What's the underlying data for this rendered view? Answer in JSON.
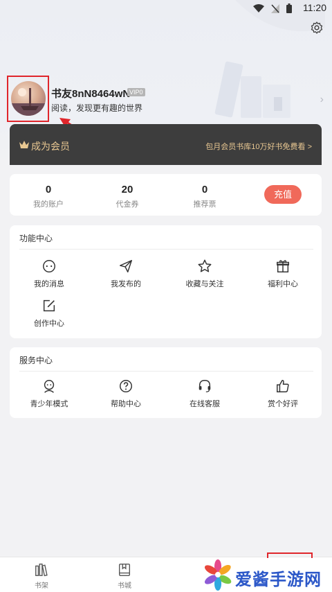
{
  "status_bar": {
    "time": "11:20"
  },
  "profile": {
    "username": "书友8nN8464wN",
    "vip_level": "VIP0",
    "signature": "阅读，发现更有趣的世界"
  },
  "vip_bar": {
    "title": "成为会员",
    "promo": "包月会员书库10万好书免费看 >"
  },
  "stats": [
    {
      "value": "0",
      "label": "我的账户"
    },
    {
      "value": "20",
      "label": "代金券"
    },
    {
      "value": "0",
      "label": "推荐票"
    }
  ],
  "recharge_label": "充值",
  "functions": {
    "title": "功能中心",
    "items": [
      {
        "label": "我的消息",
        "icon": "message-icon"
      },
      {
        "label": "我发布的",
        "icon": "send-icon"
      },
      {
        "label": "收藏与关注",
        "icon": "star-icon"
      },
      {
        "label": "福利中心",
        "icon": "gift-icon"
      },
      {
        "label": "创作中心",
        "icon": "edit-icon"
      }
    ]
  },
  "services": {
    "title": "服务中心",
    "items": [
      {
        "label": "青少年模式",
        "icon": "teen-mode-icon"
      },
      {
        "label": "帮助中心",
        "icon": "help-icon"
      },
      {
        "label": "在线客服",
        "icon": "headset-icon"
      },
      {
        "label": "赏个好评",
        "icon": "thumbs-up-icon"
      }
    ]
  },
  "bottom_nav": [
    {
      "label": "书架",
      "icon": "bookshelf-icon"
    },
    {
      "label": "书城",
      "icon": "bookstore-icon"
    }
  ],
  "watermark": {
    "text": "爱酱手游网"
  },
  "colors": {
    "accent": "#f0695a",
    "vip_gold": "#e9c892",
    "annotation_red": "#e0252b",
    "watermark_blue": "#2b57c8"
  }
}
